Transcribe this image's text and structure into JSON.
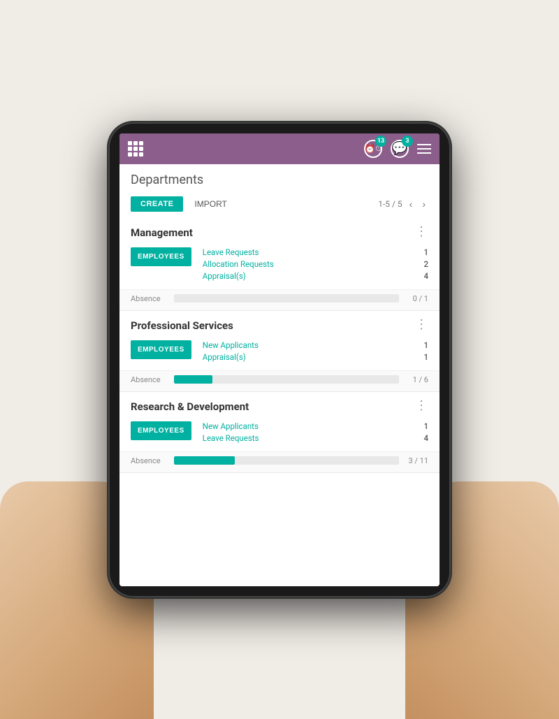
{
  "scene": {
    "background": "#e8e0d8"
  },
  "navbar": {
    "badge_clock": "13",
    "badge_chat": "3"
  },
  "page": {
    "title": "Departments",
    "toolbar": {
      "create_label": "CREATE",
      "import_label": "IMPORT",
      "pagination": "1-5 / 5"
    }
  },
  "departments": [
    {
      "name": "Management",
      "employees_label": "EMPLOYEES",
      "stats": [
        {
          "label": "Leave Requests",
          "value": "1"
        },
        {
          "label": "Allocation Requests",
          "value": "2"
        },
        {
          "label": "Appraisal(s)",
          "value": "4"
        }
      ],
      "absence": {
        "label": "Absence",
        "fill_percent": 0,
        "count": "0 / 1"
      }
    },
    {
      "name": "Professional Services",
      "employees_label": "EMPLOYEES",
      "stats": [
        {
          "label": "New Applicants",
          "value": "1"
        },
        {
          "label": "Appraisal(s)",
          "value": "1"
        }
      ],
      "absence": {
        "label": "Absence",
        "fill_percent": 17,
        "count": "1 / 6"
      }
    },
    {
      "name": "Research & Development",
      "employees_label": "EMPLOYEES",
      "stats": [
        {
          "label": "New Applicants",
          "value": "1"
        },
        {
          "label": "Leave Requests",
          "value": "4"
        }
      ],
      "absence": {
        "label": "Absence",
        "fill_percent": 27,
        "count": "3 / 11"
      }
    }
  ]
}
